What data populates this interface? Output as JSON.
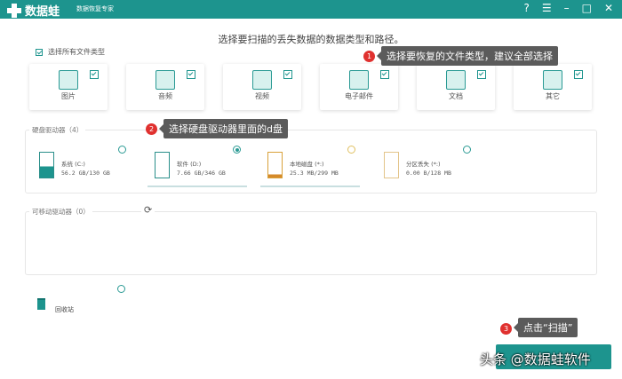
{
  "titlebar": {
    "app_name": "数据蛙",
    "subtitle": "数据恢复专家",
    "buttons": [
      "?",
      "☰",
      "–",
      "□",
      "✕"
    ]
  },
  "main": {
    "title": "选择要扫描的丢失数据的数据类型和路径。",
    "select_all": "选择所有文件类型",
    "file_types": [
      {
        "label": "图片",
        "icon": "image-icon"
      },
      {
        "label": "音频",
        "icon": "music-icon"
      },
      {
        "label": "视频",
        "icon": "video-icon"
      },
      {
        "label": "电子邮件",
        "icon": "email-icon"
      },
      {
        "label": "文档",
        "icon": "document-icon"
      },
      {
        "label": "其它",
        "icon": "other-icon"
      }
    ]
  },
  "hard_drives": {
    "legend": "硬盘驱动器（4）",
    "drives": [
      {
        "name": "系统 (C:)",
        "size": "56.2 GB/130 GB",
        "selected": false
      },
      {
        "name": "软件 (D:)",
        "size": "7.66 GB/346 GB",
        "selected": true
      },
      {
        "name": "本地磁盘 (*:)",
        "size": "25.3 MB/299 MB",
        "selected": false
      },
      {
        "name": "分区丢失 (*:)",
        "size": "0.00  B/128 MB",
        "selected": false
      }
    ]
  },
  "removable": {
    "legend": "可移动驱动器（0）"
  },
  "recycle": {
    "label": "回收站"
  },
  "callouts": [
    {
      "num": "1",
      "text": "选择要恢复的文件类型，建议全部选择"
    },
    {
      "num": "2",
      "text": "选择硬盘驱动器里面的d盘"
    },
    {
      "num": "3",
      "text": "点击“扫描”"
    }
  ],
  "watermark": "头条 @数据蛙软件",
  "colors": {
    "accent": "#1d948e",
    "callout": "#5b5b5b",
    "badge": "#e0312f"
  }
}
